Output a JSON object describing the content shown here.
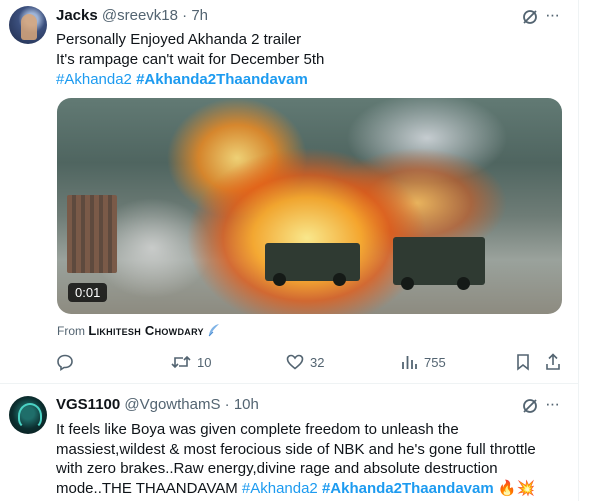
{
  "tweets": [
    {
      "name": "Jacks",
      "handle": "@sreevk18",
      "separator": "·",
      "time": "7h",
      "more": "···",
      "text_lines": [
        "Personally Enjoyed Akhanda 2 trailer",
        "It's rampage can't wait for December 5th"
      ],
      "hashtags": [
        "#Akhanda2",
        "#Akhanda2Thaandavam"
      ],
      "media": {
        "timestamp": "0:01"
      },
      "from_label": "From",
      "from_author": "Likhitesh Chowdary",
      "actions": {
        "replies": "",
        "retweets": "10",
        "likes": "32",
        "views": "755"
      }
    },
    {
      "name": "VGS1100",
      "handle": "@VgowthamS",
      "separator": "·",
      "time": "10h",
      "more": "···",
      "text_main": "It feels like Boya was given complete freedom to unleash the massiest,wildest & most ferocious side of NBK and he's gone full throttle with zero brakes..Raw energy,divine rage and absolute destruction mode..THE THAANDAVAM ",
      "hashtags": [
        "#Akhanda2",
        "#Akhanda2Thaandavam"
      ],
      "emojis": [
        "🔥",
        "💥"
      ]
    }
  ],
  "colors": {
    "link": "#1d9bf0",
    "secondary": "#536471",
    "primary": "#0f1419"
  }
}
